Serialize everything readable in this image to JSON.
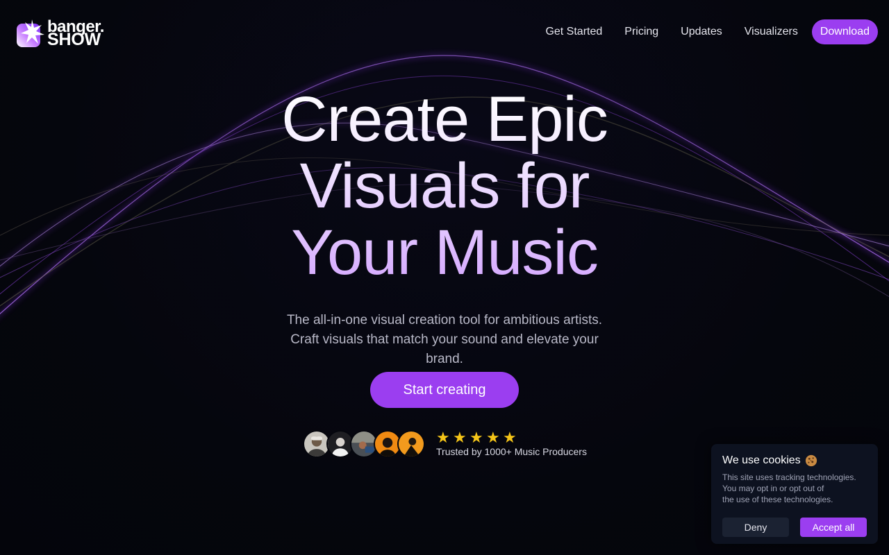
{
  "brand": {
    "name_top": "banger.",
    "name_bottom": "SHOW",
    "logo_icon": "starburst-icon",
    "accent_color": "#9b3ef0"
  },
  "nav": {
    "links": [
      "Get Started",
      "Pricing",
      "Updates",
      "Visualizers"
    ],
    "download_label": "Download"
  },
  "hero": {
    "title_lines": [
      "Create Epic",
      "Visuals for",
      "Your Music"
    ],
    "subtitle": "The all-in-one visual creation tool for ambitious artists. Craft visuals that match your sound and elevate your brand.",
    "cta_label": "Start creating"
  },
  "social_proof": {
    "avatar_count": 5,
    "rating": 5,
    "stars": [
      "★",
      "★",
      "★",
      "★",
      "★"
    ],
    "trusted_text": "Trusted by 1000+ Music Producers"
  },
  "cookie_banner": {
    "title": "We use cookies",
    "icon": "cookie-icon",
    "text_lines": [
      "This site uses tracking technologies.",
      "You may opt in or opt out of",
      "the use of these technologies."
    ],
    "deny_label": "Deny",
    "accept_label": "Accept all"
  }
}
